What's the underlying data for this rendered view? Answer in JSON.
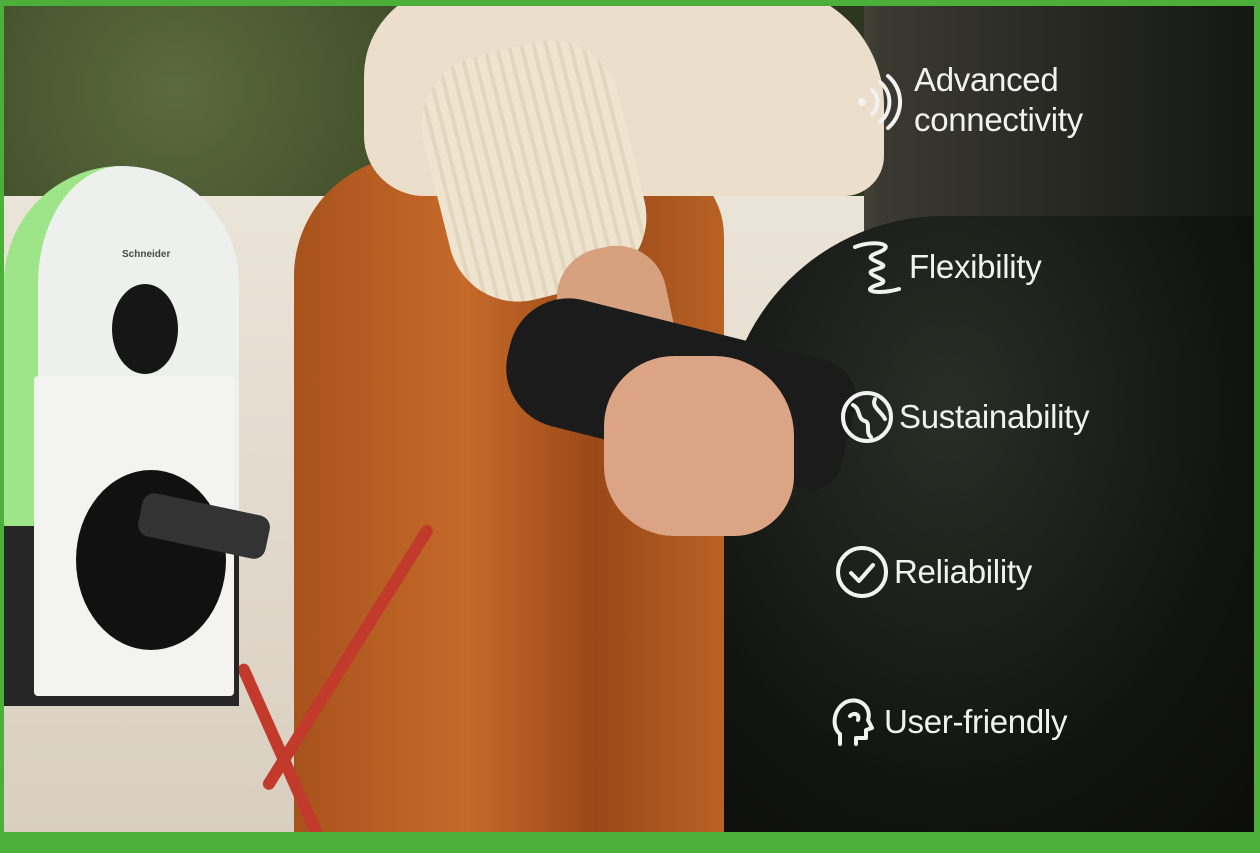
{
  "features": [
    {
      "label": "Advanced\nconnectivity",
      "icon": "wireless-signal-icon"
    },
    {
      "label": "Flexibility",
      "icon": "spring-coil-icon"
    },
    {
      "label": "Sustainability",
      "icon": "globe-leaf-icon"
    },
    {
      "label": "Reliability",
      "icon": "check-circle-icon"
    },
    {
      "label": "User-friendly",
      "icon": "user-head-icon"
    }
  ],
  "charger": {
    "brand": "Schneider"
  },
  "colors": {
    "frame": "#4caf3a",
    "accent_green": "#9ee58a",
    "text": "#f2f2f0"
  }
}
